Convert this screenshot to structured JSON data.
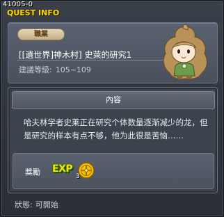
{
  "quest_id": "41005-0",
  "title": "QUEST INFO",
  "job_badge": "職業",
  "quest_name": "[[遺世界]神木村] 史萊的研究1",
  "level": {
    "label": "建議等級:",
    "range": "105~109"
  },
  "content": {
    "header": "內容",
    "description": "哈夫林学者史莱正在研究个体数量逐渐减少的龙，但是研究的样本有点不够，他为此很是苦恼……"
  },
  "reward": {
    "label": "獎勵",
    "icons": [
      "exp-icon",
      "coin-icon"
    ],
    "exp_text": "EXP",
    "item_count": "3"
  },
  "status": {
    "label": "狀態:",
    "value": "可開始"
  },
  "colors": {
    "title": "#ffd400",
    "exp": "#f5e400"
  }
}
